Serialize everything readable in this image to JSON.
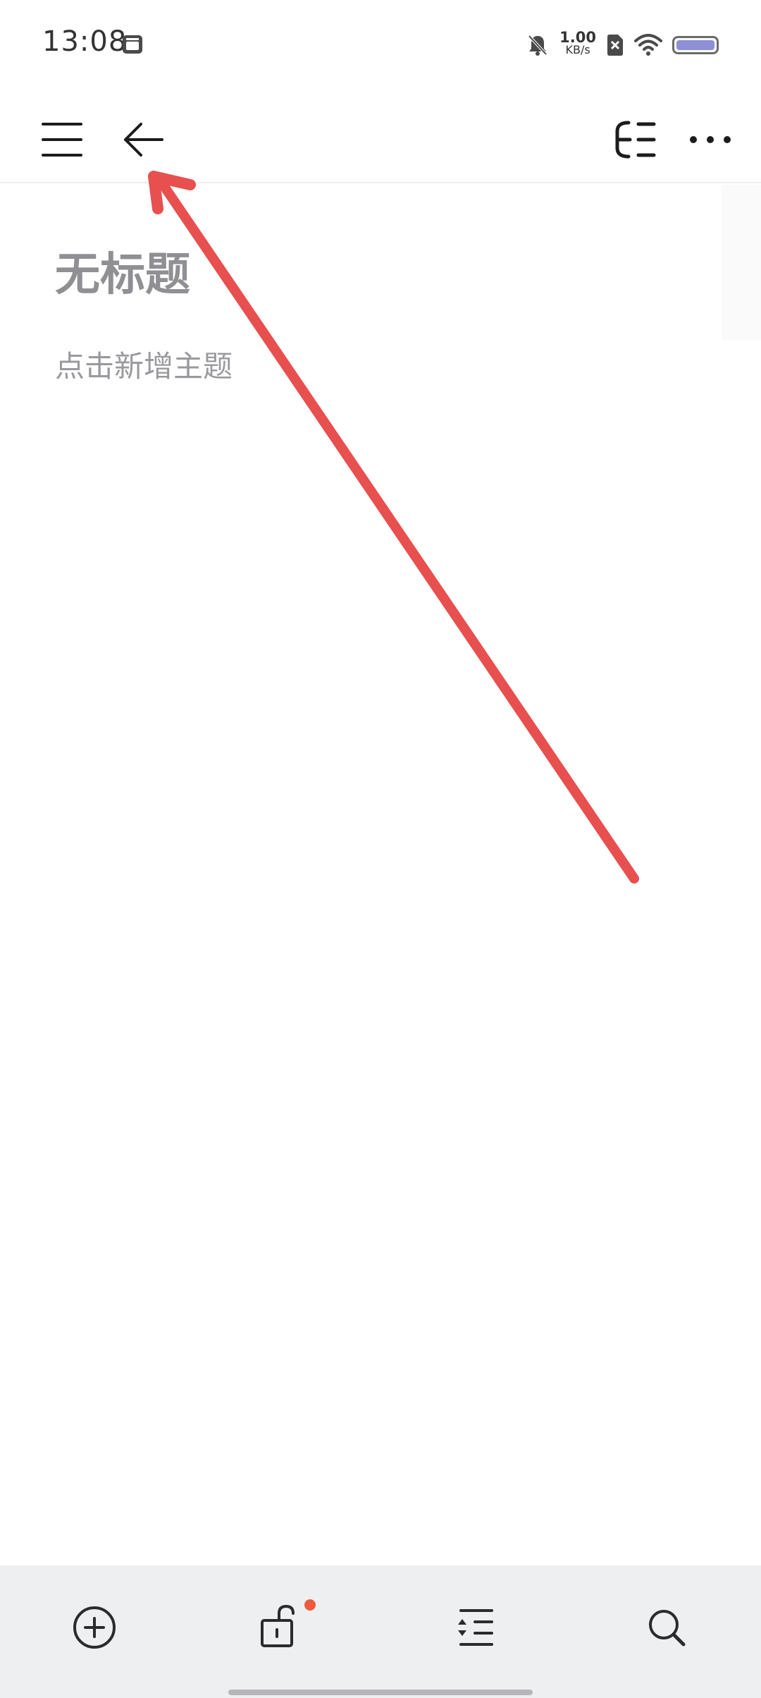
{
  "status_bar": {
    "time": "13:08",
    "net_speed_value": "1.00",
    "net_speed_unit": "KB/s",
    "icons": [
      "calendar-app-icon",
      "mute-bell-icon",
      "sim-x-icon",
      "wifi-icon",
      "battery-icon"
    ],
    "battery_color": "#8f8fd6"
  },
  "toolbar": {
    "left_icons": [
      "menu-icon",
      "back-arrow-icon"
    ],
    "right_icons": [
      "outline-toggle-icon",
      "more-icon"
    ]
  },
  "document": {
    "title": "无标题",
    "placeholder": "点击新增主题"
  },
  "annotation": {
    "color": "#e84f4f"
  },
  "bottom_bar": {
    "icons": [
      "add-topic-icon",
      "unlock-icon",
      "format-icon",
      "search-icon"
    ],
    "badge_color": "#f05a3c"
  }
}
